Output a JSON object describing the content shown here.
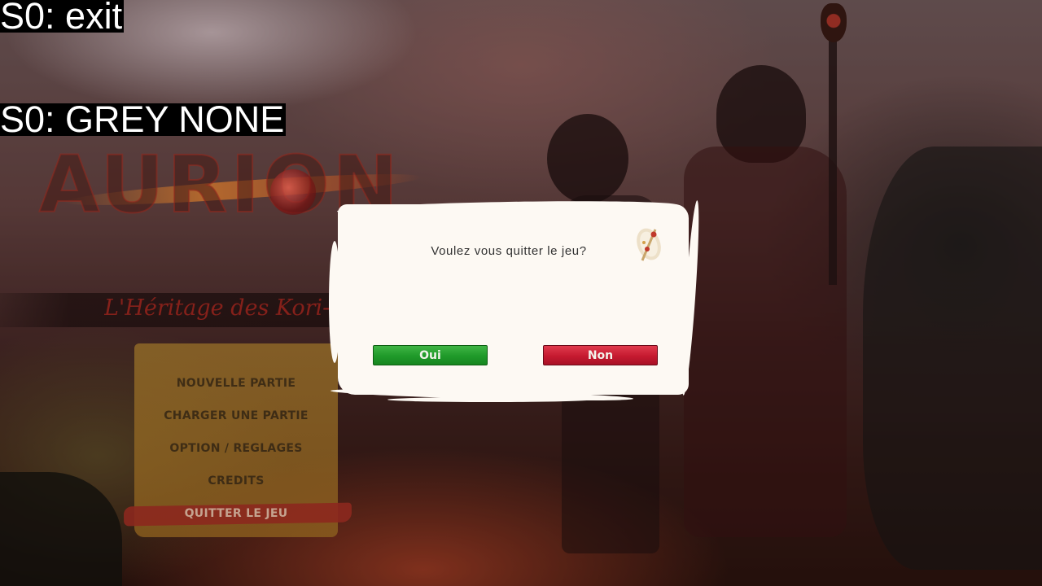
{
  "debug": {
    "line1": "S0: exit",
    "line2": "S0: GREY NONE"
  },
  "game": {
    "logo_text": "AURION",
    "subtitle": "L'Héritage des Kori-O"
  },
  "main_menu": {
    "items": [
      {
        "label": "NOUVELLE PARTIE"
      },
      {
        "label": "CHARGER UNE PARTIE"
      },
      {
        "label": "OPTION / REGLAGES"
      },
      {
        "label": "CREDITS"
      },
      {
        "label": "QUITTER LE JEU",
        "selected": true
      }
    ]
  },
  "dialog": {
    "message": "Voulez vous quitter le jeu?",
    "icon": "scroll-quill-icon",
    "confirm_label": "Oui",
    "cancel_label": "Non"
  },
  "colors": {
    "confirm": "#1f9a2a",
    "cancel": "#c51a30",
    "paper": "#fdf9f3"
  }
}
